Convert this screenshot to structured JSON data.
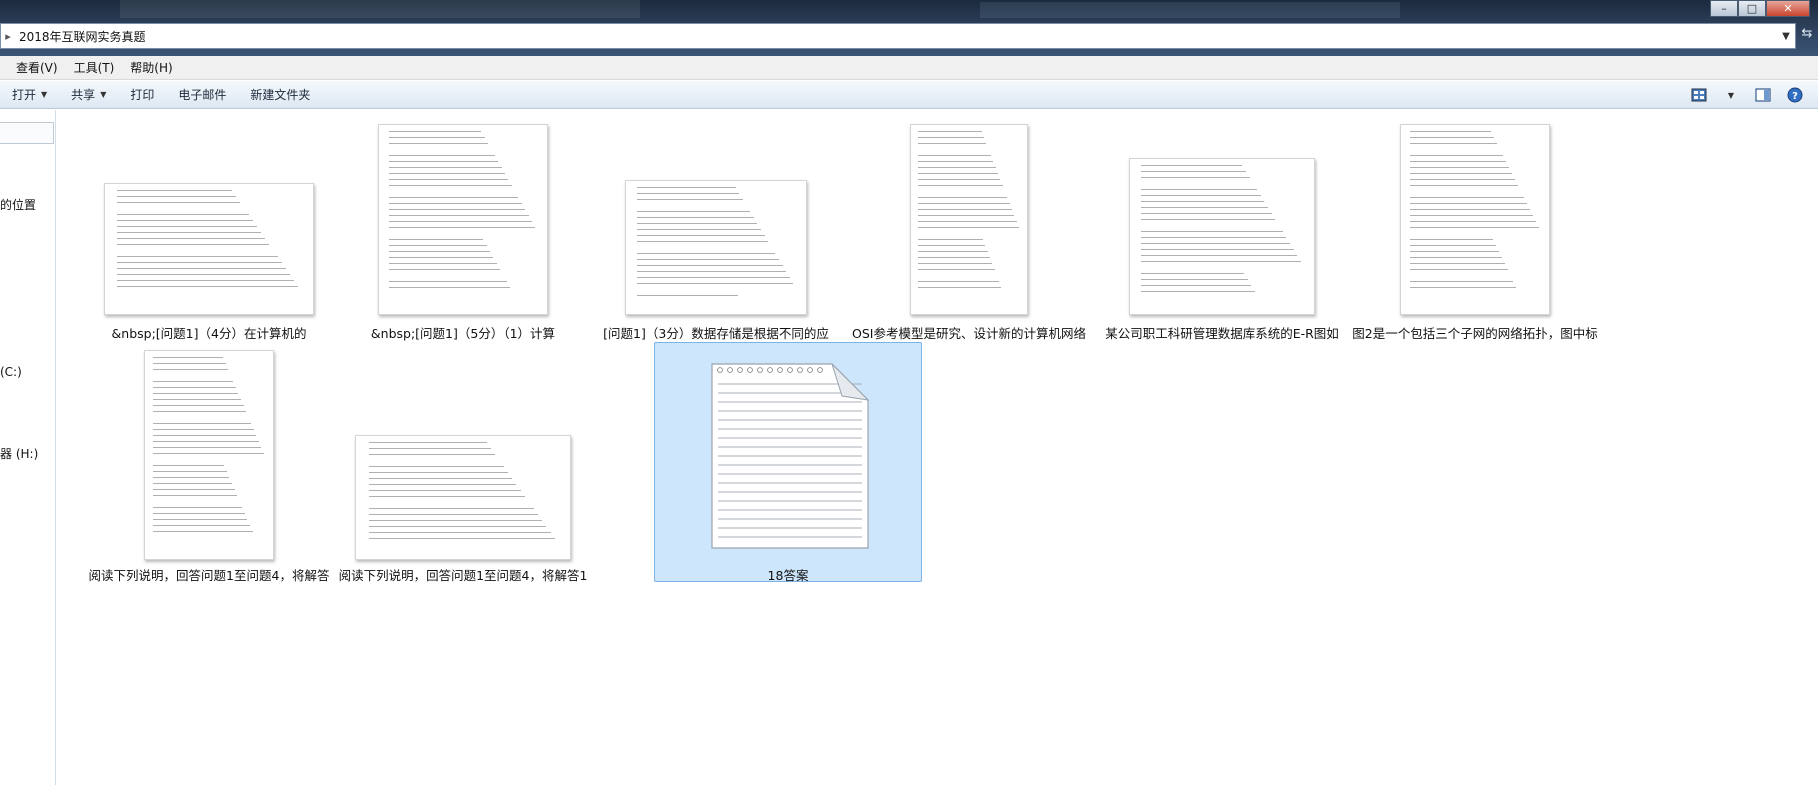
{
  "window": {
    "address_path": "2018年互联网实务真题",
    "controls": [
      "–",
      "□",
      "✕"
    ]
  },
  "menubar": {
    "items": [
      "查看(V)",
      "工具(T)",
      "帮助(H)"
    ]
  },
  "toolbar": {
    "open_label": "打开",
    "share_label": "共享",
    "print_label": "打印",
    "email_label": "电子邮件",
    "new_folder_label": "新建文件夹"
  },
  "navpane": {
    "items": [
      "的位置",
      "(C:)",
      "器 (H:)"
    ]
  },
  "files": [
    {
      "caption": "&nbsp;[问题1]（4分）在计算机的",
      "kind": "doc"
    },
    {
      "caption": "&nbsp;[问题1]（5分）（1）计算",
      "kind": "doc"
    },
    {
      "caption": "[问题1]（3分）数据存储是根据不同的应",
      "kind": "doc"
    },
    {
      "caption": "OSI参考模型是研究、设计新的计算机网络",
      "kind": "doc"
    },
    {
      "caption": "某公司职工科研管理数据库系统的E-R图如",
      "kind": "doc"
    },
    {
      "caption": "图2是一个包括三个子网的网络拓扑，图中标",
      "kind": "doc"
    },
    {
      "caption": "阅读下列说明，回答问题1至问题4，将解答",
      "kind": "doc"
    },
    {
      "caption": "阅读下列说明，回答问题1至问题4，将解答1",
      "kind": "doc"
    },
    {
      "caption": "18答案",
      "kind": "notepad",
      "selected": true
    }
  ],
  "colors": {
    "selection_fill": "#cde6fb",
    "selection_border": "#7db3e4",
    "window_chrome": "#2a3d57"
  }
}
